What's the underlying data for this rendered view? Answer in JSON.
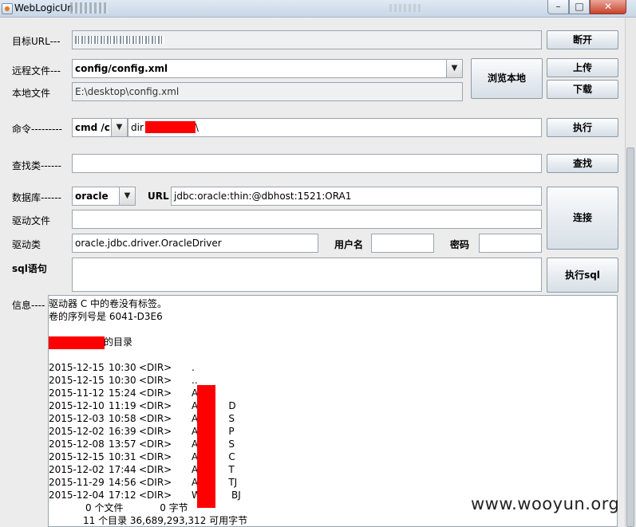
{
  "window": {
    "title": "WebLogicUn",
    "min": "–",
    "max": "□",
    "close": "✕"
  },
  "form": {
    "target_url_label": "目标URL---",
    "disconnect_button": "断开",
    "remote_file_label": "远程文件---",
    "remote_file_value": "config/config.xml",
    "browse_local_button": "浏览本地",
    "upload_button": "上传",
    "download_button": "下载",
    "local_file_label": "本地文件",
    "local_file_value": "E:\\desktop\\config.xml",
    "command_label": "命令---------",
    "command_shell": "cmd /c",
    "command_prefix": "dir",
    "command_suffix": "\\",
    "execute_button": "执行",
    "find_class_label": "查找类------",
    "find_class_value": "",
    "find_button": "查找",
    "database_label": "数据库------",
    "database_type": "oracle",
    "url_label": "URL",
    "url_value": "jdbc:oracle:thin:@dbhost:1521:ORA1",
    "connect_button": "连接",
    "driver_file_label": "驱动文件",
    "driver_file_value": "",
    "driver_class_label": "驱动类",
    "driver_class_value": "oracle.jdbc.driver.OracleDriver",
    "username_label": "用户名",
    "username_value": "",
    "password_label": "密码",
    "password_value": "",
    "sql_label": "sql语句",
    "sql_value": "",
    "execute_sql_button": "执行sql",
    "info_label": "信息----"
  },
  "info": {
    "volume_line": "驱动器 C 中的卷没有标签。",
    "serial_line": "卷的序列号是 6041-D3E6",
    "dir_of_suffix": "的目录",
    "entries": [
      {
        "date": "2015-12-15",
        "time": "10:30",
        "type": "<DIR>",
        "name": "."
      },
      {
        "date": "2015-12-15",
        "time": "10:30",
        "type": "<DIR>",
        "name": ".."
      },
      {
        "date": "2015-11-12",
        "time": "15:24",
        "type": "<DIR>",
        "name": "A"
      },
      {
        "date": "2015-12-10",
        "time": "11:19",
        "type": "<DIR>",
        "name": "A          D"
      },
      {
        "date": "2015-12-03",
        "time": "10:58",
        "type": "<DIR>",
        "name": "A          S"
      },
      {
        "date": "2015-12-02",
        "time": "16:39",
        "type": "<DIR>",
        "name": "A          P"
      },
      {
        "date": "2015-12-08",
        "time": "13:57",
        "type": "<DIR>",
        "name": "A          S"
      },
      {
        "date": "2015-12-15",
        "time": "10:31",
        "type": "<DIR>",
        "name": "A          C"
      },
      {
        "date": "2015-12-02",
        "time": "17:44",
        "type": "<DIR>",
        "name": "A          T"
      },
      {
        "date": "2015-11-29",
        "time": "14:56",
        "type": "<DIR>",
        "name": "A          TJ"
      },
      {
        "date": "2015-12-04",
        "time": "17:12",
        "type": "<DIR>",
        "name": "W          BJ"
      }
    ],
    "files_summary": "0 个文件            0 字节",
    "dirs_summary": "11 个目录 36,689,293,312 可用字节"
  },
  "watermark": "www.wooyun.org",
  "colors": {
    "redaction": "#ff0000"
  }
}
